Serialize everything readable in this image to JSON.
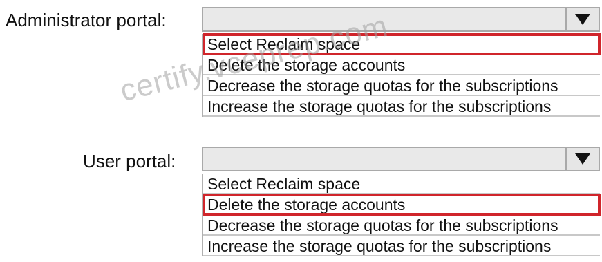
{
  "watermark": "certify.vceprep.com",
  "colors": {
    "selected_outline": "#d0252b",
    "select_background": "#e9e9e9"
  },
  "icons": {
    "dropdown_arrow": "triangle-down-icon"
  },
  "admin": {
    "label": "Administrator portal:",
    "selected_value": "",
    "options": [
      "Select Reclaim space",
      "Delete the storage accounts",
      "Decrease the storage quotas for the subscriptions",
      "Increase the storage quotas for the subscriptions"
    ],
    "highlighted_option": "Select Reclaim space"
  },
  "user": {
    "label": "User portal:",
    "selected_value": "",
    "options": [
      "Select Reclaim space",
      "Delete the storage accounts",
      "Decrease the storage quotas for the subscriptions",
      "Increase the storage quotas for the subscriptions"
    ],
    "highlighted_option": "Delete the storage accounts"
  }
}
